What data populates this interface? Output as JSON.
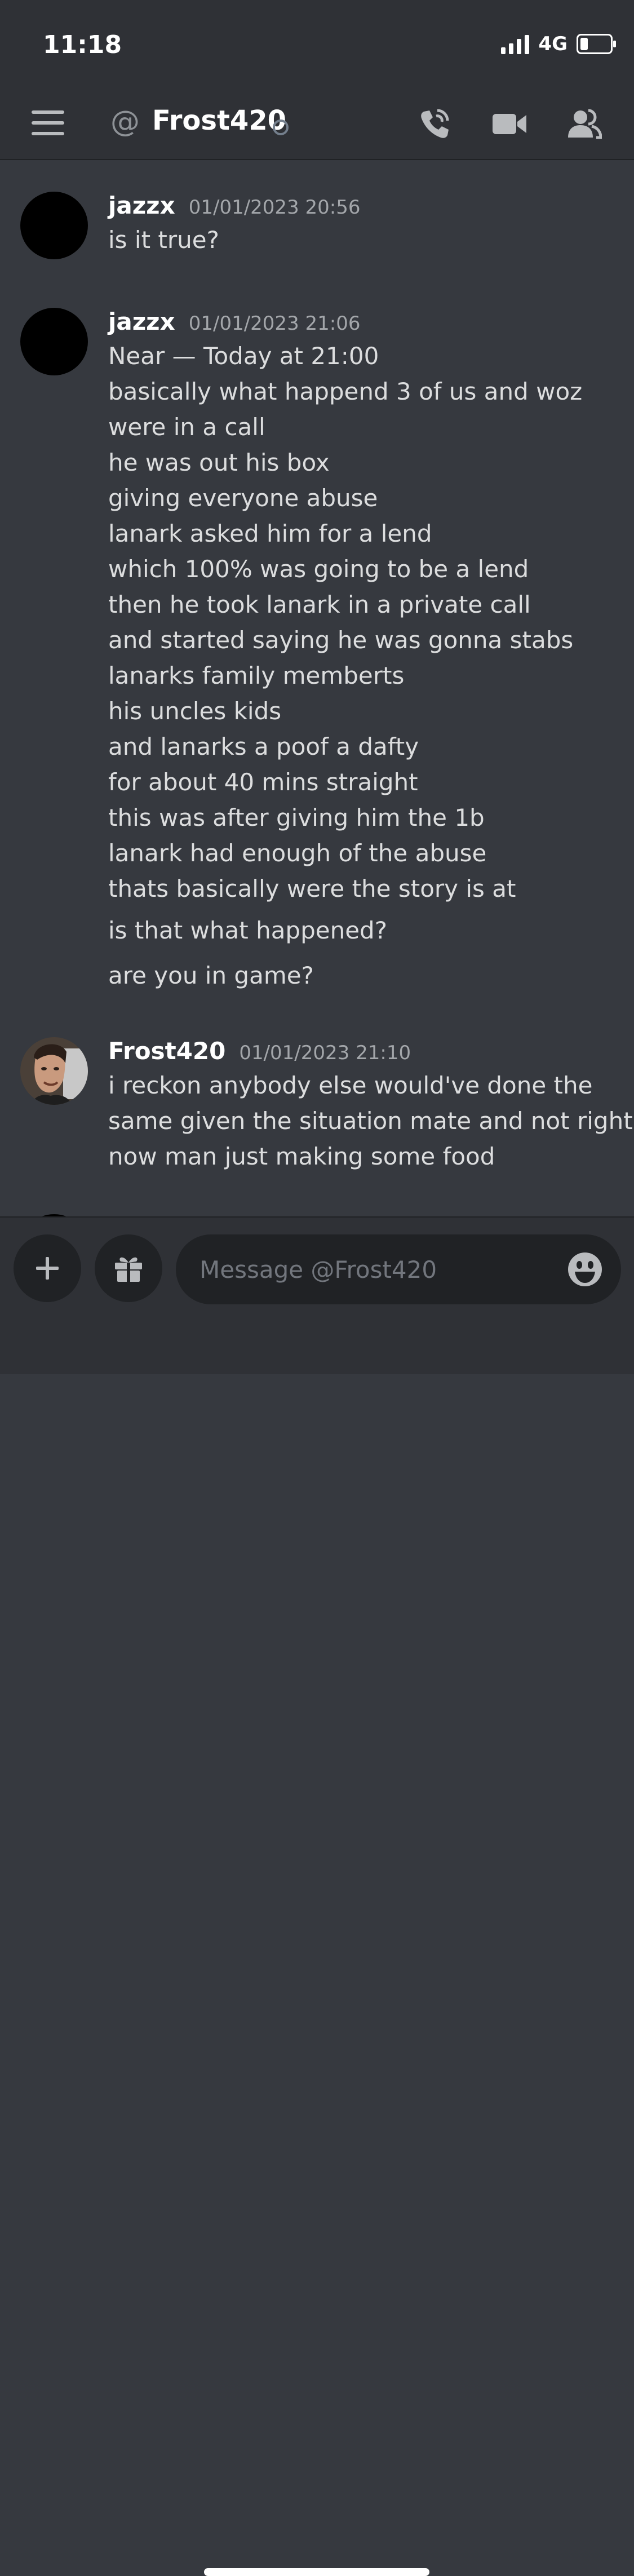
{
  "status_bar": {
    "time": "11:18",
    "network": "4G",
    "battery_percent": 25
  },
  "header": {
    "channel_prefix": "@",
    "channel_name": "Frost420"
  },
  "messages": [
    {
      "author": "jazzx",
      "timestamp": "01/01/2023 20:56",
      "lines": [
        "is it true?"
      ]
    },
    {
      "author": "jazzx",
      "timestamp": "01/01/2023 21:06",
      "lines": [
        "Near — Today at 21:00",
        "basically what happend 3 of us and woz",
        "were in a call",
        "he was out his box",
        "giving everyone abuse",
        "lanark asked him for a lend",
        "which 100% was going to be a lend",
        "then he took lanark in a private call",
        "and started saying he was gonna stabs",
        "lanarks family memberts",
        "his uncles kids",
        "and lanarks a poof a dafty",
        "for about 40 mins straight",
        "this was after giving him the 1b",
        "lanark had enough of the abuse",
        "thats basically were the story is at"
      ],
      "followups": [
        "is that what happened?",
        "are you in game?"
      ]
    },
    {
      "author": "Frost420",
      "timestamp": "01/01/2023 21:10",
      "lines": [
        "i reckon anybody else would've done the",
        "same given the situation mate and not right",
        "now man just making some food"
      ]
    }
  ],
  "composer": {
    "placeholder": "Message @Frost420"
  },
  "icons": {
    "menu": "hamburger-icon",
    "at": "at-icon",
    "voice_call": "phone-call-icon",
    "video_call": "video-camera-icon",
    "members": "members-icon",
    "add": "plus-icon",
    "gift": "gift-icon",
    "emoji": "emoji-icon"
  }
}
